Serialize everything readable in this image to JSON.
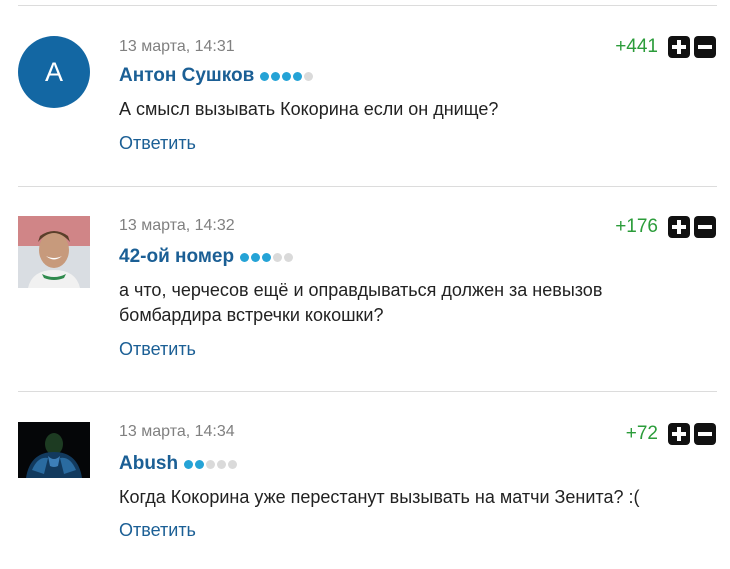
{
  "comments": [
    {
      "avatar_letter": "А",
      "date": "13 марта, 14:31",
      "author": "Антон Сушков",
      "rating_level": 4,
      "text": "А смысл вызывать Кокорина если он днище?",
      "score": "+441",
      "reply_label": "Ответить"
    },
    {
      "date": "13 марта, 14:32",
      "author": "42-ой номер",
      "rating_level": 3,
      "text": "а что, черчесов ещё и оправдываться должен за невызов бомбардира встречки кокошки?",
      "score": "+176",
      "reply_label": "Ответить"
    },
    {
      "date": "13 марта, 14:34",
      "author": "Abush",
      "rating_level": 2,
      "text": "Когда Кокорина уже перестанут вызывать на матчи Зенита? :(",
      "score": "+72",
      "reply_label": "Ответить"
    }
  ],
  "colors": {
    "author": "#1b5f95",
    "score_positive": "#2b9c3a",
    "rating_dot_active": "#25a3d6",
    "rating_dot_inactive": "#dadada",
    "avatar_letter_bg": "#1367a3"
  },
  "icons": {
    "upvote": "plus-icon",
    "downvote": "minus-icon"
  }
}
